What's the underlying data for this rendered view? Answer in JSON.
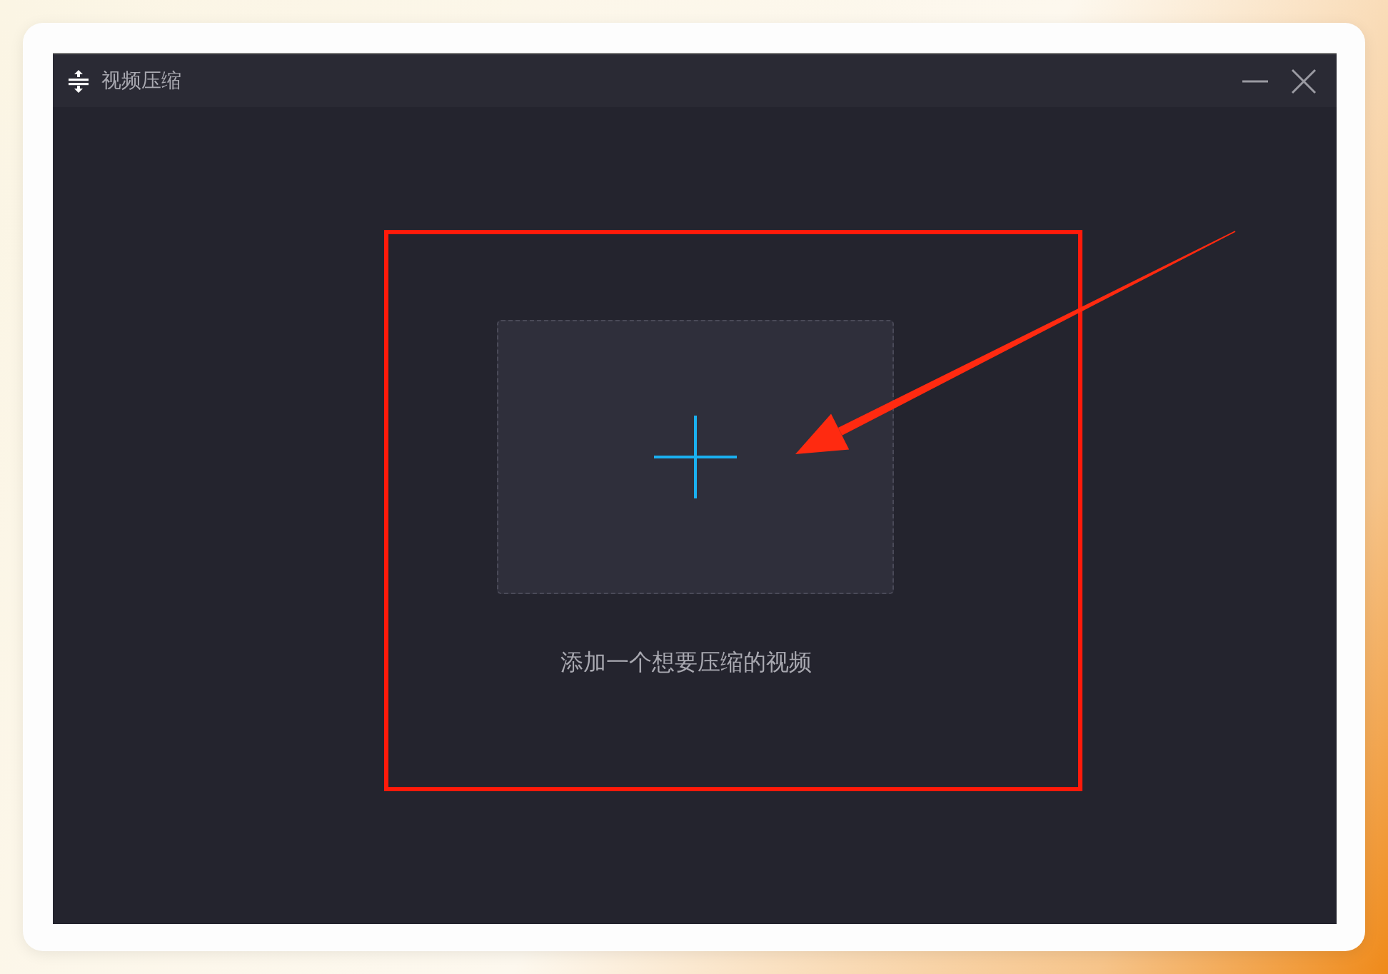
{
  "window": {
    "title": "视频压缩"
  },
  "drop_zone": {
    "hint": "添加一个想要压缩的视频"
  }
}
